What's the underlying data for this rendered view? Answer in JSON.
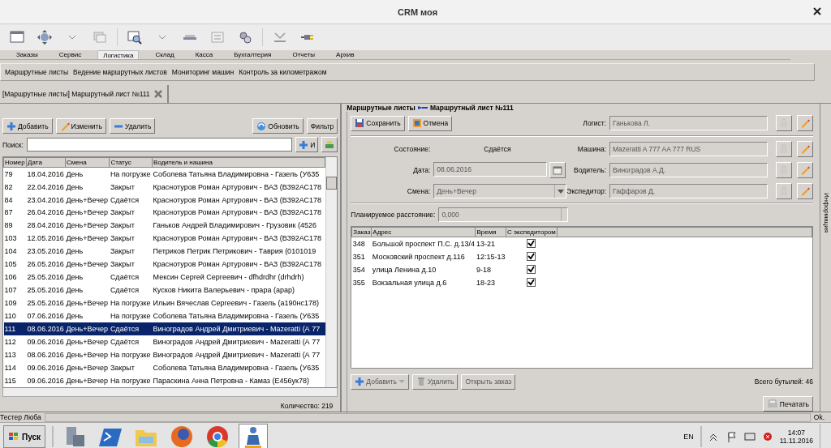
{
  "window": {
    "title": "CRM моя"
  },
  "menu_tabs": [
    {
      "label": "Заказы",
      "selected": false
    },
    {
      "label": "Сервис",
      "selected": false
    },
    {
      "label": "Логистика",
      "selected": true
    },
    {
      "label": "Склад",
      "selected": false
    },
    {
      "label": "Касса",
      "selected": false
    },
    {
      "label": "Бухгалтерия",
      "selected": false
    },
    {
      "label": "Отчеты",
      "selected": false
    },
    {
      "label": "Архив",
      "selected": false
    }
  ],
  "submenu": [
    "Маршрутные листы",
    "Ведение маршрутных листов",
    "Мониторинг машин",
    "Контроль за километражом"
  ],
  "doc_tab": {
    "label": "[Маршрутные листы] Маршрутный лист №111"
  },
  "breadcrumb": {
    "parent": "Маршрутные листы",
    "current": "Маршрутный лист №111"
  },
  "list_panel": {
    "buttons": [
      {
        "label": "Добавить",
        "kind": "add"
      },
      {
        "label": "Изменить",
        "kind": "edit"
      },
      {
        "label": "Удалить",
        "kind": "remove"
      }
    ],
    "right_buttons": [
      {
        "label": "Обновить",
        "kind": "refresh"
      },
      {
        "label": "Фильтр",
        "kind": "plain"
      }
    ],
    "search": {
      "label": "Поиск:",
      "and_button": "И"
    },
    "columns": [
      "Номер",
      "Дата",
      "Смена",
      "Статус",
      "Водитель и нашина"
    ],
    "rows": [
      {
        "cells": [
          "79",
          "18.04.2016",
          "День",
          "На погрузке",
          "Соболева Татьяна Владимировна - Газель (У635"
        ],
        "selected": false
      },
      {
        "cells": [
          "82",
          "22.04.2016",
          "День",
          "Закрыт",
          "Краснотуров Роман Артурович - ВАЗ (В392АС178"
        ],
        "selected": false
      },
      {
        "cells": [
          "84",
          "23.04.2016",
          "День+Вечер",
          "Сдаётся",
          "Краснотуров Роман Артурович - ВАЗ (В392АС178"
        ],
        "selected": false
      },
      {
        "cells": [
          "87",
          "26.04.2016",
          "День+Вечер",
          "Закрыт",
          "Краснотуров Роман Артурович - ВАЗ (В392АС178"
        ],
        "selected": false
      },
      {
        "cells": [
          "89",
          "28.04.2016",
          "День+Вечер",
          "Закрыт",
          "Ганьков Андрей Владимирович - Грузовик (4526"
        ],
        "selected": false
      },
      {
        "cells": [
          "103",
          "12.05.2016",
          "День+Вечер",
          "Закрыт",
          "Краснотуров Роман Артурович - ВАЗ (В392АС178"
        ],
        "selected": false
      },
      {
        "cells": [
          "104",
          "23.05.2016",
          "День",
          "Закрыт",
          "Петриков Петрик Петрикович - Таврия (0101019"
        ],
        "selected": false
      },
      {
        "cells": [
          "105",
          "26.05.2016",
          "День+Вечер",
          "Закрыт",
          "Краснотуров Роман Артурович - ВАЗ (В392АС178"
        ],
        "selected": false
      },
      {
        "cells": [
          "106",
          "25.05.2016",
          "День",
          "Сдаётся",
          "Мексин Сергей Сергеевич - dfhdrdhr (drhdrh)"
        ],
        "selected": false
      },
      {
        "cells": [
          "107",
          "25.05.2016",
          "День",
          "Сдаётся",
          "Кусков Никита Валерьевич - прара (арар)"
        ],
        "selected": false
      },
      {
        "cells": [
          "109",
          "25.05.2016",
          "День+Вечер",
          "На погрузке",
          "Ильин Вячеслав Сергеевич - Газель (а190нс178)"
        ],
        "selected": false
      },
      {
        "cells": [
          "110",
          "07.06.2016",
          "День",
          "На погрузке",
          "Соболева Татьяна Владимировна - Газель (У635"
        ],
        "selected": false
      },
      {
        "cells": [
          "111",
          "08.06.2016",
          "День+Вечер",
          "Сдаётся",
          "Виноградов Андрей Дмитриевич - Mazeratti (А 77"
        ],
        "selected": true
      },
      {
        "cells": [
          "112",
          "09.06.2016",
          "День+Вечер",
          "Сдаётся",
          "Виноградов Андрей Дмитриевич - Mazeratti (А 77"
        ],
        "selected": false
      },
      {
        "cells": [
          "113",
          "08.06.2016",
          "День+Вечер",
          "На погрузке",
          "Виноградов Андрей Дмитриевич - Mazeratti (А 77"
        ],
        "selected": false
      },
      {
        "cells": [
          "114",
          "09.06.2016",
          "День+Вечер",
          "Закрыт",
          "Соболева Татьяна Владимировна - Газель (У635"
        ],
        "selected": false
      },
      {
        "cells": [
          "115",
          "09.06.2016",
          "День+Вечер",
          "На погрузке",
          "Параскина Анна Петровна - Камаз (Е456ук78)"
        ],
        "selected": false
      }
    ],
    "count": "Количество: 219"
  },
  "form": {
    "buttons": [
      {
        "label": "Сохранить",
        "kind": "save"
      },
      {
        "label": "Отмена",
        "kind": "cancel"
      }
    ],
    "state": {
      "label": "Состояние:",
      "value": "Сдаётся"
    },
    "date": {
      "label": "Дата:",
      "value": "08.06.2016"
    },
    "shift": {
      "label": "Смена:",
      "value": "День+Вечер"
    },
    "people": [
      {
        "label": "Логист:",
        "value": "Ганькова Л."
      },
      {
        "label": "Машина:",
        "value": "Mazeratti A 777 AA 777 RUS"
      },
      {
        "label": "Водитель:",
        "value": "Виноградов А.Д."
      },
      {
        "label": "Экспедитор:",
        "value": "Гаффаров Д."
      }
    ],
    "distance": {
      "label": "Планируемое расстояние:",
      "value": "0,000"
    },
    "columns": [
      "Заказ",
      "Адрес",
      "Время",
      "С экспедитором"
    ],
    "orders": [
      {
        "order": "348",
        "address": "Большой проспект П.С. д.13/4",
        "time": "13-21",
        "checked": true
      },
      {
        "order": "351",
        "address": "Московский проспект д.116",
        "time": "12:15-13",
        "checked": true
      },
      {
        "order": "354",
        "address": "улица Ленина д.10",
        "time": "9-18",
        "checked": true
      },
      {
        "order": "355",
        "address": "Вокзальная улица д.6",
        "time": "18-23",
        "checked": true
      }
    ],
    "order_buttons": [
      {
        "label": "Добавить",
        "kind": "add",
        "disabled": true
      },
      {
        "label": "Удалить",
        "kind": "trash",
        "disabled": true
      },
      {
        "label": "Открыть заказ",
        "kind": "plain",
        "disabled": true
      }
    ],
    "total": "Всего бутылей: 46",
    "print": "Печатать"
  },
  "side_panel": {
    "label": "Информация"
  },
  "status_bar": {
    "user": "Тестер Люба",
    "message": "Ok."
  },
  "taskbar": {
    "start": "Пуск",
    "language": "EN",
    "time": "14:07",
    "date": "11.11.2016"
  }
}
